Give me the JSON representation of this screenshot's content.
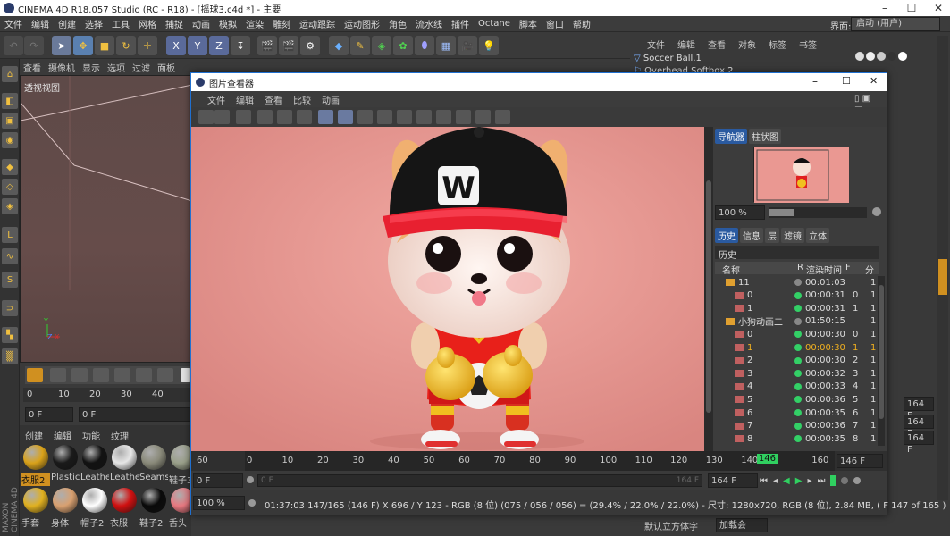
{
  "app": {
    "title": "CINEMA 4D R18.057 Studio (RC - R18) - [摇球3.c4d *] - 主要",
    "menu": [
      "文件",
      "编辑",
      "创建",
      "选择",
      "工具",
      "网格",
      "捕捉",
      "动画",
      "模拟",
      "渲染",
      "雕刻",
      "运动跟踪",
      "运动图形",
      "角色",
      "流水线",
      "插件",
      "Octane",
      "脚本",
      "窗口",
      "帮助"
    ],
    "layout_label": "界面:",
    "layout_value": "启动 (用户)"
  },
  "viewport": {
    "menu": [
      "查看",
      "摄像机",
      "显示",
      "选项",
      "过滤",
      "面板"
    ],
    "label": "透视视图"
  },
  "timeline_left": {
    "ticks": [
      "0",
      "10",
      "20",
      "30",
      "40"
    ],
    "frame_field": "0 F",
    "frame_field2": "0 F"
  },
  "materials": {
    "menu": [
      "创建",
      "编辑",
      "功能",
      "纹理"
    ],
    "row1": [
      {
        "label": "衣服2",
        "color": "#d9a21a"
      },
      {
        "label": "Plastic",
        "color": "#1a1a1a"
      },
      {
        "label": "Leathe",
        "color": "#121212"
      },
      {
        "label": "Leathe",
        "color": "#e6e6e6"
      },
      {
        "label": "Seams",
        "color": "#8a8a7a"
      },
      {
        "label": "鞋子3",
        "color": "#9aa08a"
      }
    ],
    "row2": [
      {
        "label": "手套",
        "color": "#e0b020"
      },
      {
        "label": "身体",
        "color": "#d8a070"
      },
      {
        "label": "帽子2",
        "color": "#ffffff"
      },
      {
        "label": "衣服",
        "color": "#d01010"
      },
      {
        "label": "鞋子2",
        "color": "#0a0a0a"
      },
      {
        "label": "舌头",
        "color": "#e87880"
      }
    ]
  },
  "objects": {
    "menu": [
      "文件",
      "编辑",
      "查看",
      "对象",
      "标签",
      "书签"
    ],
    "items": [
      "Soccer Ball.1",
      "Overhead Softbox 2"
    ]
  },
  "right_fields": [
    "164 F",
    "164 F",
    "164 F"
  ],
  "right_bottom": [
    "默认立方体字",
    "加载会"
  ],
  "picture_viewer": {
    "title": "图片查看器",
    "menu": [
      "文件",
      "编辑",
      "查看",
      "比较",
      "动画"
    ],
    "nav_tabs": [
      "导航器",
      "柱状图"
    ],
    "zoom": "100 %",
    "hist_tabs": [
      "历史",
      "信息",
      "层",
      "滤镜",
      "立体"
    ],
    "hist_title": "历史",
    "hist_columns": [
      "名称",
      "R",
      "渲染时间",
      "F",
      "分"
    ],
    "history": [
      {
        "name": "11",
        "time": "00:01:03",
        "f": "",
        "g": "1",
        "folder": true,
        "dot": "#888888",
        "selected": false
      },
      {
        "name": "0",
        "time": "00:00:31",
        "f": "0",
        "g": "1",
        "folder": false,
        "dot": "#33d066",
        "selected": false
      },
      {
        "name": "1",
        "time": "00:00:31",
        "f": "1",
        "g": "1",
        "folder": false,
        "dot": "#33d066",
        "selected": false
      },
      {
        "name": "小狗动画二",
        "time": "01:50:15",
        "f": "",
        "g": "1",
        "folder": true,
        "dot": "#888888",
        "selected": false
      },
      {
        "name": "0",
        "time": "00:00:30",
        "f": "0",
        "g": "1",
        "folder": false,
        "dot": "#33d066",
        "selected": false
      },
      {
        "name": "1",
        "time": "00:00:30",
        "f": "1",
        "g": "1",
        "folder": false,
        "dot": "#33d066",
        "selected": true
      },
      {
        "name": "2",
        "time": "00:00:30",
        "f": "2",
        "g": "1",
        "folder": false,
        "dot": "#33d066",
        "selected": false
      },
      {
        "name": "3",
        "time": "00:00:32",
        "f": "3",
        "g": "1",
        "folder": false,
        "dot": "#33d066",
        "selected": false
      },
      {
        "name": "4",
        "time": "00:00:33",
        "f": "4",
        "g": "1",
        "folder": false,
        "dot": "#33d066",
        "selected": false
      },
      {
        "name": "5",
        "time": "00:00:36",
        "f": "5",
        "g": "1",
        "folder": false,
        "dot": "#33d066",
        "selected": false
      },
      {
        "name": "6",
        "time": "00:00:35",
        "f": "6",
        "g": "1",
        "folder": false,
        "dot": "#33d066",
        "selected": false
      },
      {
        "name": "7",
        "time": "00:00:36",
        "f": "7",
        "g": "1",
        "folder": false,
        "dot": "#33d066",
        "selected": false
      },
      {
        "name": "8",
        "time": "00:00:35",
        "f": "8",
        "g": "1",
        "folder": false,
        "dot": "#33d066",
        "selected": false
      }
    ],
    "ruler": {
      "start": "60",
      "ticks": [
        "0",
        "10",
        "20",
        "30",
        "40",
        "50",
        "60",
        "70",
        "80",
        "90",
        "100",
        "110",
        "120",
        "130",
        "140",
        "160"
      ],
      "current": "146",
      "end_field": "146 F"
    },
    "playbar": {
      "start_field": "0 F",
      "slider_left": "0 F",
      "slider_right": "164 F",
      "end_field": "164 F"
    },
    "status": {
      "zoom": "100 %",
      "info": "01:37:03 147/165 (146 F)  X 696 / Y 123 - RGB (8 位) (075 / 056 / 056) = (29.4% / 22.0% / 22.0%) - 尺寸: 1280x720, RGB (8 位), 2.84 MB, ( F 147 of 165 )"
    },
    "cap_letter": "W"
  }
}
